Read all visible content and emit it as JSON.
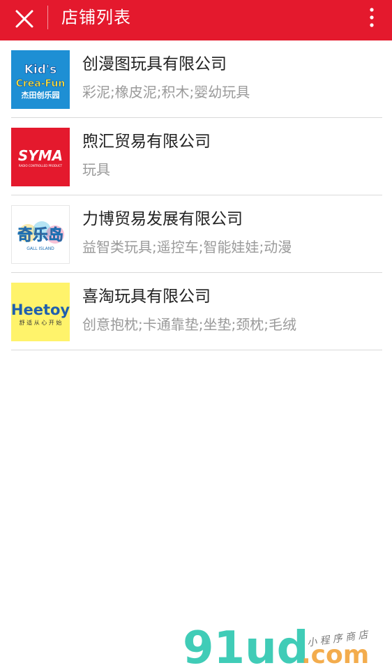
{
  "header": {
    "title": "店铺列表",
    "close_icon": "close-icon",
    "more_icon": "more-vertical-icon",
    "color": "#e4192d"
  },
  "shops": [
    {
      "name": "创漫图玩具有限公司",
      "tags": "彩泥;橡皮泥;积木;婴幼玩具",
      "logo": {
        "line1": "Kid's",
        "line2": "Crea-Fun",
        "line3": "杰田创乐园"
      }
    },
    {
      "name": "煦汇贸易有限公司",
      "tags": "玩具",
      "logo": {
        "line1": "SYMA",
        "line2": "RADIO CONTROLLED PRODUCT"
      }
    },
    {
      "name": "力博贸易发展有限公司",
      "tags": "益智类玩具;遥控车;智能娃娃;动漫",
      "logo": {
        "line1": "奇乐岛",
        "line2": "GALL ISLAND"
      }
    },
    {
      "name": "喜淘玩具有限公司",
      "tags": "创意抱枕;卡通靠垫;坐垫;颈枕;毛绒",
      "logo": {
        "line1": "Heetoy",
        "line2": "舒 适 从 心 开 始"
      }
    }
  ],
  "watermark": {
    "brand": "91ud",
    "domain": ".com",
    "slogan": "小 程 序 商 店"
  }
}
